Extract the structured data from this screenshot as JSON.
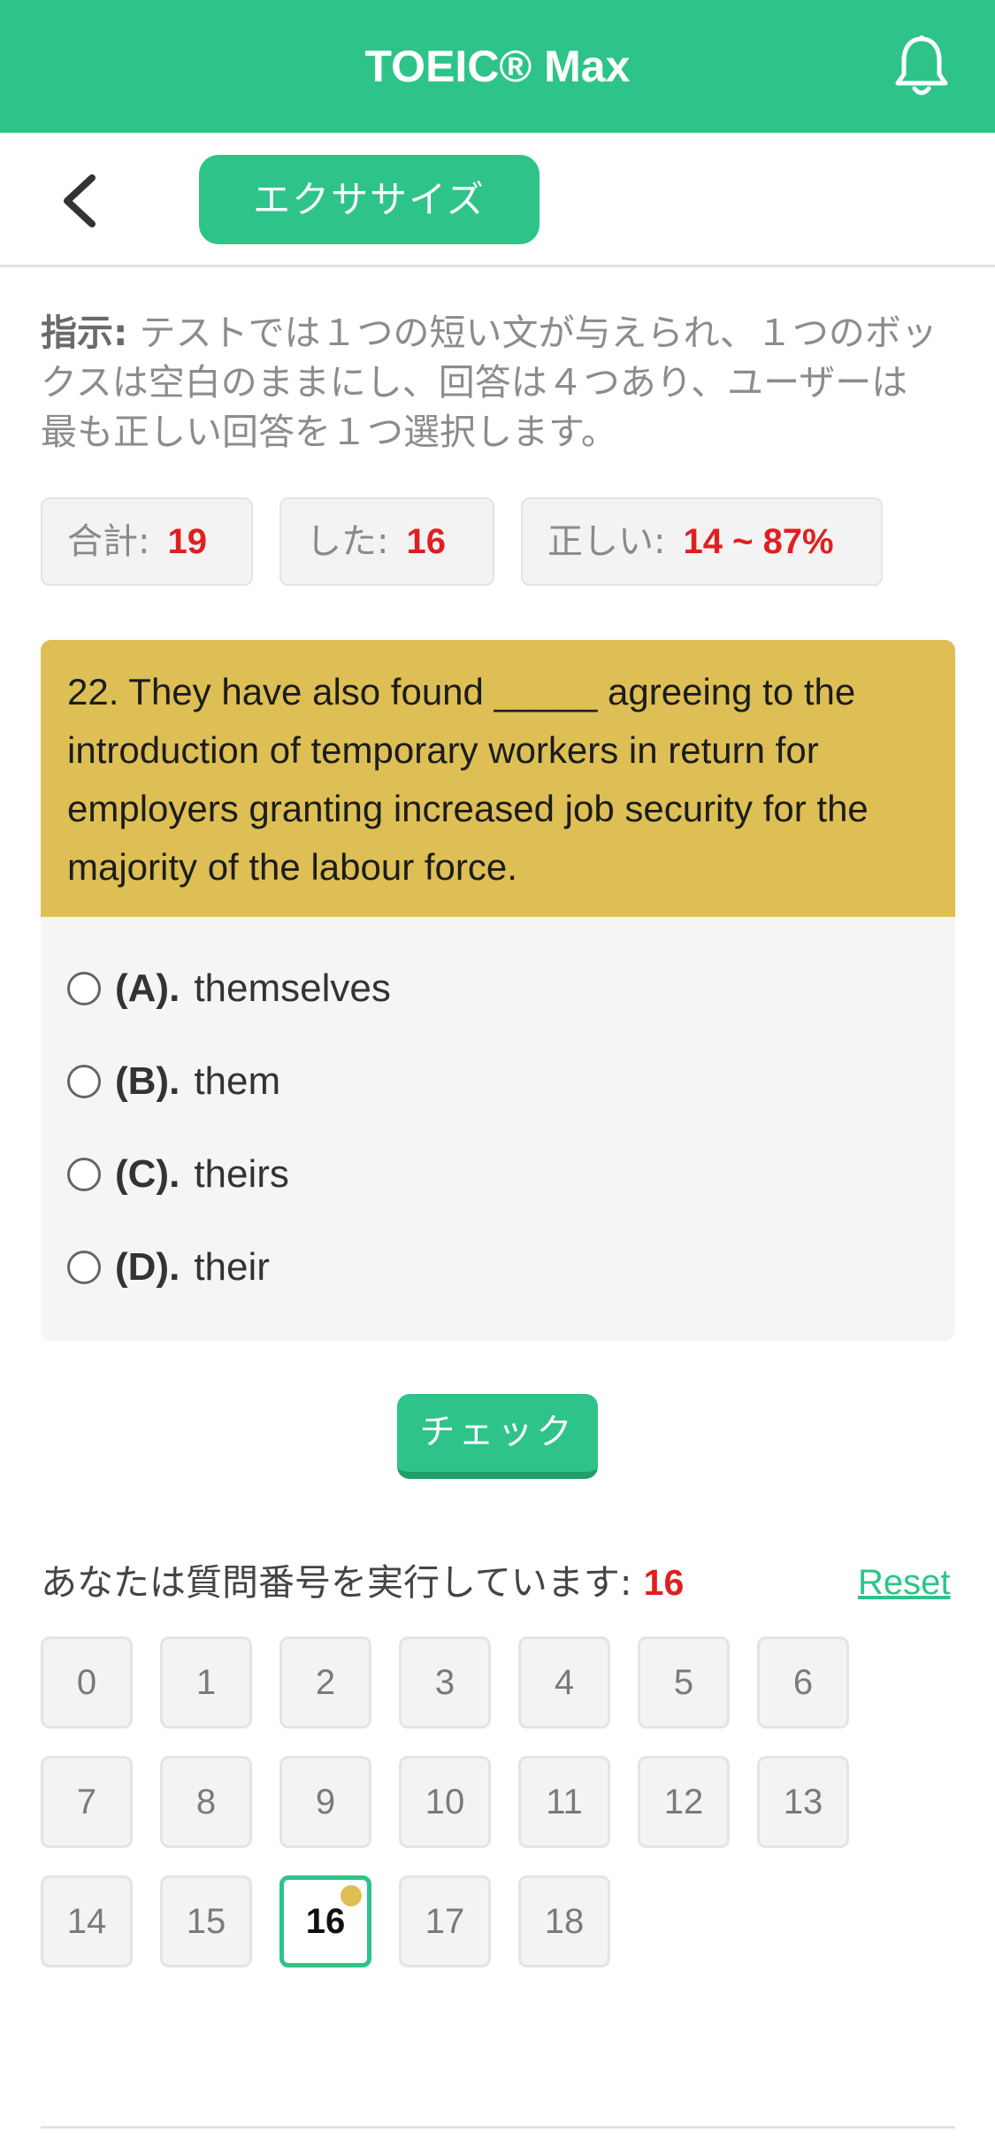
{
  "app": {
    "title": "TOEIC® Max",
    "bell_icon": "bell-icon",
    "accent_color": "#2ec489"
  },
  "nav": {
    "back_icon": "chevron-left-icon",
    "exercise_label": "エクササイズ"
  },
  "instructions": {
    "label": "指示:",
    "text": "テストでは１つの短い文が与えられ、１つのボックスは空白のままにし、回答は４つあり、ユーザーは最も正しい回答を１つ選択します。"
  },
  "stats": {
    "total_label": "合計:",
    "total_value": "19",
    "done_label": "した:",
    "done_value": "16",
    "correct_label": "正しい:",
    "correct_value": "14 ~ 87%"
  },
  "question": {
    "text": "22. They have also found _____ agreeing to the introduction of temporary workers in return for employers granting increased job security for the majority of the labour force.",
    "options": [
      {
        "letter": "(A).",
        "text": "themselves"
      },
      {
        "letter": "(B).",
        "text": "them"
      },
      {
        "letter": "(C).",
        "text": "theirs"
      },
      {
        "letter": "(D).",
        "text": "their"
      }
    ]
  },
  "check_label": "チェック",
  "progress": {
    "running_label": "あなたは質問番号を実行しています:",
    "current": "16",
    "reset_label": "Reset",
    "numbers": [
      "0",
      "1",
      "2",
      "3",
      "4",
      "5",
      "6",
      "7",
      "8",
      "9",
      "10",
      "11",
      "12",
      "13",
      "14",
      "15",
      "16",
      "17",
      "18"
    ]
  }
}
